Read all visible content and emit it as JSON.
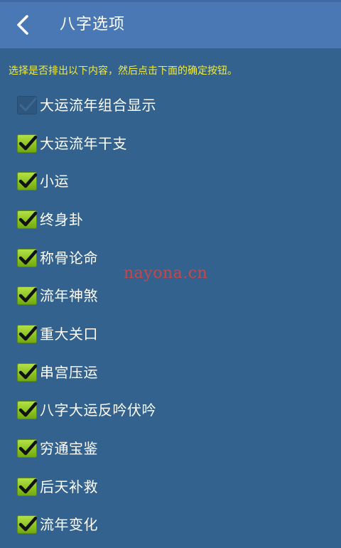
{
  "header": {
    "title": "八字选项",
    "back_icon": "chevron-left-icon"
  },
  "hint": "选择是否排出以下内容，然后点击下面的确定按钮。",
  "watermark": "nayona.cn",
  "colors": {
    "background": "#34628f",
    "topbar": "#4978b5",
    "hint_text": "#f2ec3a",
    "checkbox_green": "#8cc521",
    "watermark": "#e0423e"
  },
  "options": [
    {
      "label": "大运流年组合显示",
      "checked": true,
      "enabled": false
    },
    {
      "label": "大运流年干支",
      "checked": true,
      "enabled": true
    },
    {
      "label": "小运",
      "checked": true,
      "enabled": true
    },
    {
      "label": "终身卦",
      "checked": true,
      "enabled": true
    },
    {
      "label": "称骨论命",
      "checked": true,
      "enabled": true
    },
    {
      "label": "流年神煞",
      "checked": true,
      "enabled": true
    },
    {
      "label": "重大关口",
      "checked": true,
      "enabled": true
    },
    {
      "label": "串宫压运",
      "checked": true,
      "enabled": true
    },
    {
      "label": "八字大运反吟伏吟",
      "checked": true,
      "enabled": true
    },
    {
      "label": "穷通宝鉴",
      "checked": true,
      "enabled": true
    },
    {
      "label": "后天补救",
      "checked": true,
      "enabled": true
    },
    {
      "label": "流年变化",
      "checked": true,
      "enabled": true
    }
  ]
}
